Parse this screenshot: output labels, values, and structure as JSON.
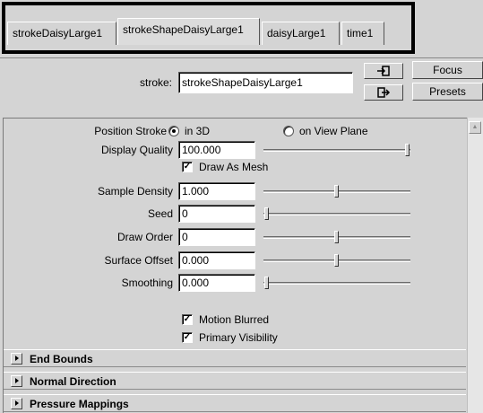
{
  "tabs": [
    {
      "label": "strokeDaisyLarge1",
      "active": false
    },
    {
      "label": "strokeShapeDaisyLarge1",
      "active": true
    },
    {
      "label": "daisyLarge1",
      "active": false
    },
    {
      "label": "time1",
      "active": false
    }
  ],
  "header": {
    "stroke_label": "stroke:",
    "stroke_value": "strokeShapeDaisyLarge1",
    "focus_label": "Focus",
    "presets_label": "Presets"
  },
  "attributes": {
    "position_stroke": {
      "label": "Position Stroke",
      "option_3d": "in 3D",
      "option_view_plane": "on View Plane",
      "selected": "in 3D"
    },
    "display_quality": {
      "label": "Display Quality",
      "value": "100.000",
      "slider_fraction": 1.0
    },
    "draw_as_mesh": {
      "label": "Draw As Mesh",
      "checked": true
    },
    "sample_density": {
      "label": "Sample Density",
      "value": "1.000",
      "slider_fraction": 0.5
    },
    "seed": {
      "label": "Seed",
      "value": "0",
      "slider_fraction": 0.0
    },
    "draw_order": {
      "label": "Draw Order",
      "value": "0",
      "slider_fraction": 0.5
    },
    "surface_offset": {
      "label": "Surface Offset",
      "value": "0.000",
      "slider_fraction": 0.5
    },
    "smoothing": {
      "label": "Smoothing",
      "value": "0.000",
      "slider_fraction": 0.0
    },
    "motion_blurred": {
      "label": "Motion Blurred",
      "checked": true
    },
    "primary_visibility": {
      "label": "Primary Visibility",
      "checked": true
    }
  },
  "sections": [
    {
      "label": "End Bounds"
    },
    {
      "label": "Normal Direction"
    },
    {
      "label": "Pressure Mappings"
    }
  ],
  "colors": {
    "panel_bg": "#d4d4d4",
    "field_bg": "#ffffff",
    "highlight_box": "#000000"
  },
  "icons": {
    "select_node": "arrow-into-box-icon",
    "show_node": "arrow-out-box-icon",
    "scroll_up": "scroll-up-arrow-icon",
    "section_expand": "triangle-right-icon",
    "checkmark": "check-icon"
  }
}
